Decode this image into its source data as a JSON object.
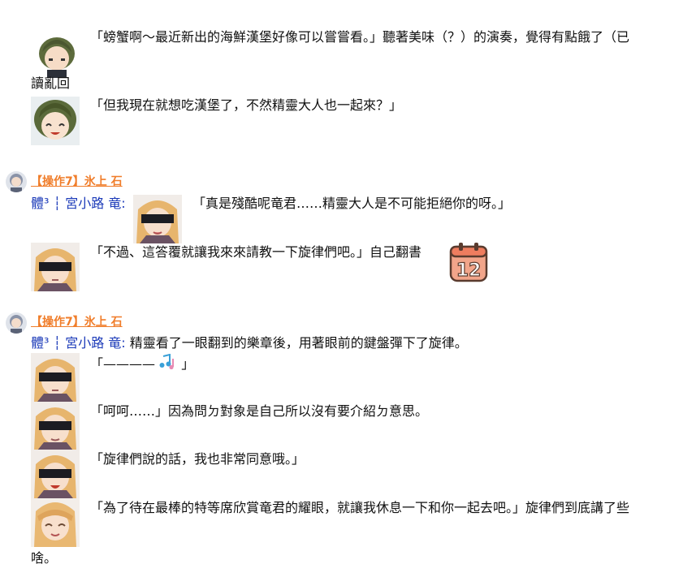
{
  "blocks": [
    {
      "lines": [
        "「螃蟹啊～最近新出的海鮮漢堡好像可以嘗嘗看。」聽著美味（？）的演奏，覺得有點餓了（已",
        "讀亂回",
        "「但我現在就想吃漢堡了，不然精靈大人也一起來？」"
      ]
    },
    {
      "user": "【操作7】氷上 石",
      "speaker": "體³ ┆ 宮小路 竜:",
      "lines": [
        "「真是殘酷呢竜君……精靈大人是不可能拒絕你的呀。」",
        "「不過、這答覆就讓我來來請教一下旋律們吧。」自己翻書"
      ],
      "sticker_number": "12"
    },
    {
      "user": "【操作7】氷上 石",
      "speaker": "體³ ┆ 宮小路 竜:",
      "lines": [
        "精靈看了一眼翻到的樂章後，用著眼前的鍵盤彈下了旋律。",
        "「————",
        "」",
        "「呵呵……」因為問ㄉ對象是自己所以沒有要介紹ㄉ意思。",
        "「旋律們說的話，我也非常同意哦。」",
        "「為了待在最棒的特等席欣賞竜君的耀眼，就讓我休息一下和你一起去吧。」旋律們到底講了些",
        "啥。"
      ]
    }
  ]
}
